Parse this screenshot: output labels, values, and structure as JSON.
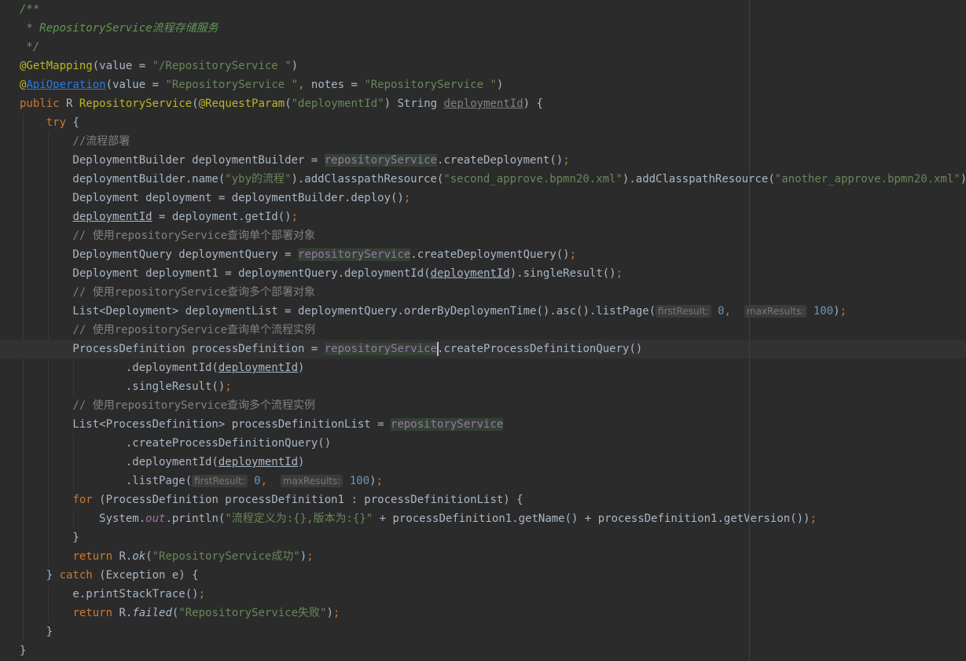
{
  "editor": {
    "language": "java",
    "colors": {
      "background": "#2b2b2b",
      "default_text": "#a9b7c6",
      "keyword": "#cc7832",
      "string": "#6a8759",
      "number": "#6897bb",
      "comment": "#808080",
      "doc_comment": "#629755",
      "annotation": "#bbb529",
      "usage_highlight": "#344134",
      "current_line": "#323232"
    },
    "lines": [
      {
        "tokens": [
          {
            "t": "/**",
            "c": "doc"
          }
        ]
      },
      {
        "tokens": [
          {
            "t": " * RepositoryService流程存储服务",
            "c": "doc"
          }
        ]
      },
      {
        "tokens": [
          {
            "t": " */",
            "c": "doc"
          }
        ]
      },
      {
        "tokens": [
          {
            "t": "@GetMapping",
            "c": "ann"
          },
          {
            "t": "(value = "
          },
          {
            "t": "\"/RepositoryService \"",
            "c": "str"
          },
          {
            "t": ")"
          }
        ]
      },
      {
        "tokens": [
          {
            "t": "@",
            "c": "ann"
          },
          {
            "t": "ApiOperation",
            "c": "link"
          },
          {
            "t": "(value = "
          },
          {
            "t": "\"RepositoryService \"",
            "c": "str"
          },
          {
            "t": ", ",
            "c": "kw"
          },
          {
            "t": "notes = "
          },
          {
            "t": "\"RepositoryService \"",
            "c": "str"
          },
          {
            "t": ")"
          }
        ]
      },
      {
        "tokens": [
          {
            "t": "public ",
            "c": "kw"
          },
          {
            "t": "R "
          },
          {
            "t": "RepositoryService",
            "c": "ann"
          },
          {
            "t": "("
          },
          {
            "t": "@RequestParam",
            "c": "ann"
          },
          {
            "t": "("
          },
          {
            "t": "\"deploymentId\"",
            "c": "str"
          },
          {
            "t": ") String "
          },
          {
            "t": "deploymentId",
            "c": "ul com"
          },
          {
            "t": ") {"
          }
        ]
      },
      {
        "tokens": [
          {
            "t": "    "
          },
          {
            "t": "try ",
            "c": "kw"
          },
          {
            "t": "{"
          }
        ]
      },
      {
        "tokens": [
          {
            "t": "        "
          },
          {
            "t": "//流程部署",
            "c": "com"
          }
        ]
      },
      {
        "tokens": [
          {
            "t": "        DeploymentBuilder deploymentBuilder = "
          },
          {
            "t": "repositoryService",
            "c": "svc"
          },
          {
            "t": ".createDeployment()"
          },
          {
            "t": ";",
            "c": "kw"
          }
        ]
      },
      {
        "tokens": [
          {
            "t": "        deploymentBuilder.name("
          },
          {
            "t": "\"yby的流程\"",
            "c": "str"
          },
          {
            "t": ").addClasspathResource("
          },
          {
            "t": "\"second_approve.bpmn20.xml\"",
            "c": "str"
          },
          {
            "t": ").addClasspathResource("
          },
          {
            "t": "\"another_approve.bpmn20.xml\"",
            "c": "str"
          },
          {
            "t": ")"
          },
          {
            "t": ";",
            "c": "kw"
          }
        ]
      },
      {
        "tokens": [
          {
            "t": "        Deployment deployment = deploymentBuilder.deploy()"
          },
          {
            "t": ";",
            "c": "kw"
          }
        ]
      },
      {
        "tokens": [
          {
            "t": "        "
          },
          {
            "t": "deploymentId",
            "c": "ul"
          },
          {
            "t": " = deployment.getId()"
          },
          {
            "t": ";",
            "c": "kw"
          }
        ]
      },
      {
        "tokens": [
          {
            "t": "        "
          },
          {
            "t": "// 使用repositoryService查询单个部署对象",
            "c": "com"
          }
        ]
      },
      {
        "tokens": [
          {
            "t": "        DeploymentQuery deploymentQuery = "
          },
          {
            "t": "repositoryService",
            "c": "svc"
          },
          {
            "t": ".createDeploymentQuery()"
          },
          {
            "t": ";",
            "c": "kw"
          }
        ]
      },
      {
        "tokens": [
          {
            "t": "        Deployment deployment1 = deploymentQuery.deploymentId("
          },
          {
            "t": "deploymentId",
            "c": "ul"
          },
          {
            "t": ").singleResult()"
          },
          {
            "t": ";",
            "c": "kw"
          }
        ]
      },
      {
        "tokens": [
          {
            "t": "        "
          },
          {
            "t": "// 使用repositoryService查询多个部署对象",
            "c": "com"
          }
        ]
      },
      {
        "tokens": [
          {
            "t": "        List<Deployment> deploymentList = deploymentQuery.orderByDeploymenTime().asc().listPage("
          },
          {
            "t": "firstResult:",
            "c": "hint"
          },
          {
            "t": " "
          },
          {
            "t": "0",
            "c": "num"
          },
          {
            "t": ", ",
            "c": "kw"
          },
          {
            "t": " "
          },
          {
            "t": "maxResults:",
            "c": "hint"
          },
          {
            "t": " "
          },
          {
            "t": "100",
            "c": "num"
          },
          {
            "t": ")"
          },
          {
            "t": ";",
            "c": "kw"
          }
        ]
      },
      {
        "tokens": [
          {
            "t": "        "
          },
          {
            "t": "// 使用repositoryService查询单个流程实例",
            "c": "com"
          }
        ]
      },
      {
        "current": true,
        "tokens": [
          {
            "t": "        ProcessDefinition processDefinition = "
          },
          {
            "t": "repositoryService",
            "c": "svc"
          },
          {
            "t": ".createProcessDefinitionQuery()"
          }
        ]
      },
      {
        "tokens": [
          {
            "t": "                .deploymentId("
          },
          {
            "t": "deploymentId",
            "c": "ul"
          },
          {
            "t": ")"
          }
        ]
      },
      {
        "tokens": [
          {
            "t": "                .singleResult()"
          },
          {
            "t": ";",
            "c": "kw"
          }
        ]
      },
      {
        "tokens": [
          {
            "t": "        "
          },
          {
            "t": "// 使用repositoryService查询多个流程实例",
            "c": "com"
          }
        ]
      },
      {
        "tokens": [
          {
            "t": "        List<ProcessDefinition> processDefinitionList = "
          },
          {
            "t": "repositoryService",
            "c": "svc"
          }
        ]
      },
      {
        "tokens": [
          {
            "t": "                .createProcessDefinitionQuery()"
          }
        ]
      },
      {
        "tokens": [
          {
            "t": "                .deploymentId("
          },
          {
            "t": "deploymentId",
            "c": "ul"
          },
          {
            "t": ")"
          }
        ]
      },
      {
        "tokens": [
          {
            "t": "                .listPage("
          },
          {
            "t": "firstResult:",
            "c": "hint"
          },
          {
            "t": " "
          },
          {
            "t": "0",
            "c": "num"
          },
          {
            "t": ", ",
            "c": "kw"
          },
          {
            "t": " "
          },
          {
            "t": "maxResults:",
            "c": "hint"
          },
          {
            "t": " "
          },
          {
            "t": "100",
            "c": "num"
          },
          {
            "t": ")"
          },
          {
            "t": ";",
            "c": "kw"
          }
        ]
      },
      {
        "tokens": [
          {
            "t": "        "
          },
          {
            "t": "for ",
            "c": "kw"
          },
          {
            "t": "(ProcessDefinition processDefinition1 : processDefinitionList) {"
          }
        ]
      },
      {
        "tokens": [
          {
            "t": "            System."
          },
          {
            "t": "out",
            "c": "field"
          },
          {
            "t": ".println("
          },
          {
            "t": "\"流程定义为:{},版本为:{}\"",
            "c": "str"
          },
          {
            "t": " + processDefinition1.getName() + processDefinition1.getVersion())"
          },
          {
            "t": ";",
            "c": "kw"
          }
        ]
      },
      {
        "tokens": [
          {
            "t": "        }"
          }
        ]
      },
      {
        "tokens": [
          {
            "t": "        "
          },
          {
            "t": "return ",
            "c": "kw"
          },
          {
            "t": "R."
          },
          {
            "t": "ok",
            "c": "ital"
          },
          {
            "t": "("
          },
          {
            "t": "\"RepositoryService成功\"",
            "c": "str"
          },
          {
            "t": ")"
          },
          {
            "t": ";",
            "c": "kw"
          }
        ]
      },
      {
        "tokens": [
          {
            "t": "    } "
          },
          {
            "t": "catch ",
            "c": "kw"
          },
          {
            "t": "(Exception e) {"
          }
        ]
      },
      {
        "tokens": [
          {
            "t": "        e.printStackTrace()"
          },
          {
            "t": ";",
            "c": "kw"
          }
        ]
      },
      {
        "tokens": [
          {
            "t": "        "
          },
          {
            "t": "return ",
            "c": "kw"
          },
          {
            "t": "R."
          },
          {
            "t": "failed",
            "c": "ital"
          },
          {
            "t": "("
          },
          {
            "t": "\"RepositoryService失败\"",
            "c": "str"
          },
          {
            "t": ")"
          },
          {
            "t": ";",
            "c": "kw"
          }
        ]
      },
      {
        "tokens": [
          {
            "t": "    }"
          }
        ]
      },
      {
        "tokens": [
          {
            "t": "}"
          }
        ]
      }
    ]
  }
}
